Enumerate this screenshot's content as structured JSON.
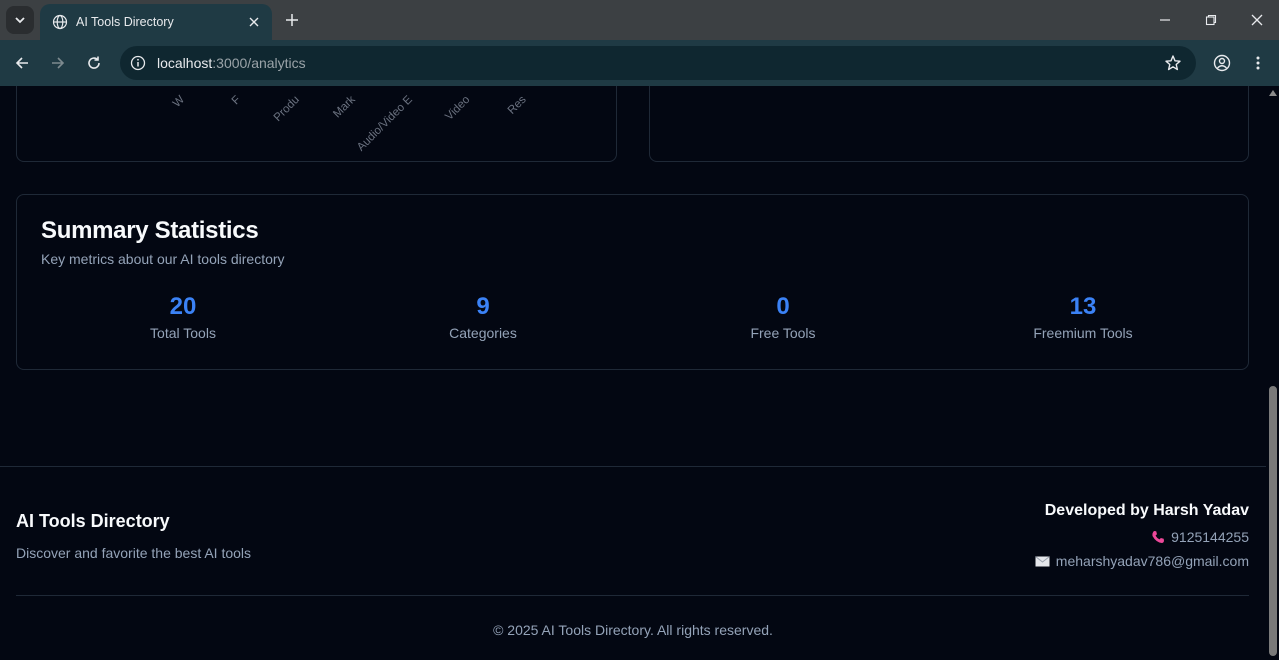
{
  "browser": {
    "tab_title": "AI Tools Directory",
    "url_host": "localhost",
    "url_path": ":3000/analytics"
  },
  "chart_partial": {
    "tick_labels": [
      "W",
      "F",
      "Produ",
      "Mark",
      "Audio/Video E",
      "Video",
      "Res",
      ""
    ]
  },
  "summary": {
    "title": "Summary Statistics",
    "description": "Key metrics about our AI tools directory",
    "stats": [
      {
        "value": "20",
        "label": "Total Tools"
      },
      {
        "value": "9",
        "label": "Categories"
      },
      {
        "value": "0",
        "label": "Free Tools"
      },
      {
        "value": "13",
        "label": "Freemium Tools"
      }
    ]
  },
  "footer": {
    "brand_title": "AI Tools Directory",
    "brand_description": "Discover and favorite the best AI tools",
    "developer": "Developed by Harsh Yadav",
    "phone": "9125144255",
    "email": "meharshyadav786@gmail.com",
    "copyright": "© 2025 AI Tools Directory. All rights reserved."
  },
  "colors": {
    "accent": "#3b82f6",
    "background": "#030712",
    "border": "#1f2937",
    "muted_text": "#94a3b8",
    "phone_icon": "#ec4899"
  },
  "icons": [
    "chevron-down-icon",
    "globe-icon",
    "close-icon",
    "plus-icon",
    "minimize-icon",
    "restore-icon",
    "back-icon",
    "forward-icon",
    "reload-icon",
    "info-icon",
    "star-icon",
    "profile-icon",
    "more-icon",
    "phone-icon",
    "mail-icon"
  ]
}
